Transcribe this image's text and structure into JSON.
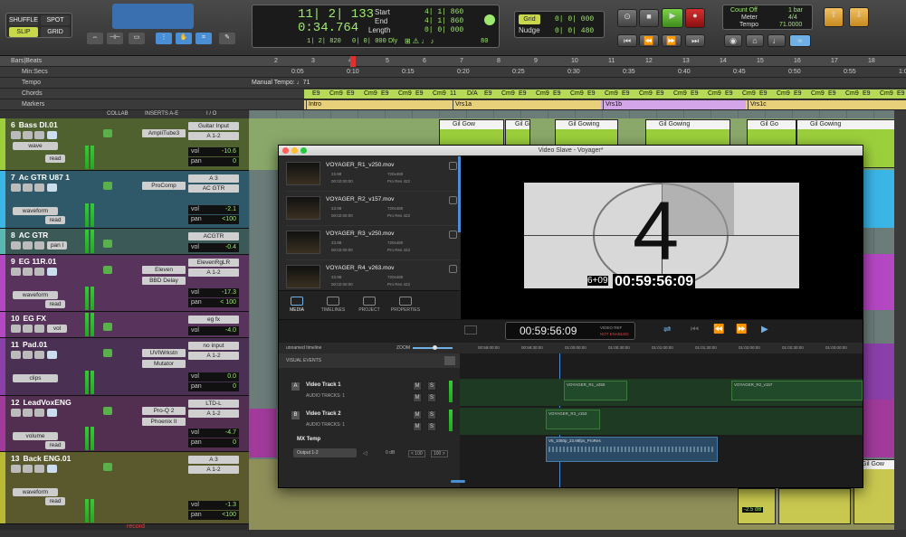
{
  "toolbar": {
    "mode_buttons": [
      "SHUFFLE",
      "SPOT",
      "SLIP",
      "GRID"
    ],
    "counter_main": "11| 2| 133",
    "counter_sub": "0:34.764",
    "start_label": "Start",
    "end_label": "End",
    "length_label": "Length",
    "start_value": "4| 1| 860",
    "end_value": "4| 1| 860",
    "length_value": "0| 0| 000",
    "pre_value": "1| 2| 820",
    "post_value": "0| 0| 000",
    "dly_label": "Dly",
    "tempo_small": "80",
    "grid_label": "Grid",
    "grid_value": "0| 0| 000",
    "nudge_label": "Nudge",
    "nudge_value": "0| 0| 480",
    "count_off": "Count Off",
    "bar_label": "1 bar",
    "meter_label": "Meter",
    "meter_value": "4/4",
    "tempo_label": "Tempo",
    "tempo_value": "71.0000"
  },
  "rulers": {
    "row_names": [
      "Bars|Beats",
      "Min:Secs",
      "Tempo",
      "Chords",
      "Markers"
    ],
    "bar_ticks": [
      "2",
      "3",
      "4",
      "5",
      "6",
      "7",
      "8",
      "9",
      "10",
      "11",
      "12",
      "13",
      "14",
      "15",
      "16",
      "17",
      "18"
    ],
    "time_ticks": [
      "0:05",
      "0:10",
      "0:15",
      "0:20",
      "0:25",
      "0:30",
      "0:35",
      "0:40",
      "0:45",
      "0:50",
      "0:55",
      "1:00"
    ],
    "manual_tempo": "Manual Tempo: ♩71",
    "chords": [
      "E9",
      "Cm9",
      "E9",
      "Cm9",
      "E9",
      "Cm9",
      "E9",
      "Cm9",
      "11",
      "D/A",
      "E9",
      "Cm9",
      "E9",
      "Cm9",
      "E9",
      "Cm9",
      "E9",
      "Cm9",
      "E9",
      "Cm9",
      "E9",
      "Cm9",
      "E9",
      "Cm9",
      "E9",
      "Cm9",
      "E9",
      "Cm9",
      "E9",
      "Cm9",
      "E9",
      "Cm9",
      "E9",
      "Cm9",
      "E9"
    ],
    "markers": [
      "Intro",
      "Vrs1a",
      "Vrs1b",
      "Vrs1c"
    ]
  },
  "mix_headers": {
    "collab": "COLLAB",
    "inserts": "INSERTS A-E",
    "io": "I / O"
  },
  "tracks": [
    {
      "num": "6",
      "name": "Bass DI.01",
      "color": "#9ccf3c",
      "view": "wave",
      "mode": "read",
      "insert1": "AmpliTube3",
      "insert2": "",
      "io_in": "Guitar Input",
      "io_out": "A 1-2",
      "vol": "-10.6",
      "pan": "0"
    },
    {
      "num": "7",
      "name": "Ac GTR U87 1",
      "color": "#3ab5e6",
      "view": "waveform",
      "mode": "read",
      "insert1": "ProComp",
      "insert2": "",
      "io_in": "A 3",
      "io_out": "AC GTR",
      "vol": "-2.1",
      "pan": "<100"
    },
    {
      "num": "8",
      "name": "AC GTR",
      "color": "#59b8b0",
      "view": "pan l",
      "mode": "",
      "insert1": "",
      "insert2": "",
      "io_in": "ACGTR",
      "io_out": "",
      "vol": "-0.4",
      "pan": ""
    },
    {
      "num": "9",
      "name": "EG 11R.01",
      "color": "#b447c2",
      "view": "waveform",
      "mode": "read",
      "insert1": "Eleven",
      "insert2": "BBD Delay",
      "io_in": "ElevenRgLR",
      "io_out": "A 1-2",
      "vol": "-17.3",
      "pan": "< 100"
    },
    {
      "num": "10",
      "name": "EG FX",
      "color": "#b447c2",
      "view": "vol",
      "mode": "",
      "insert1": "",
      "insert2": "",
      "io_in": "eg fx",
      "io_out": "",
      "vol": "-4.0",
      "pan": ""
    },
    {
      "num": "11",
      "name": "Pad.01",
      "color": "#8b3fa8",
      "view": "clips",
      "mode": "",
      "insert1": "UVIWrkstn",
      "insert2": "Mutator",
      "io_in": "no input",
      "io_out": "A 1-2",
      "vol": "0.0",
      "pan": "0"
    },
    {
      "num": "12",
      "name": "LeadVoxENG",
      "color": "#a13a9b",
      "view": "volume",
      "mode": "read",
      "insert1": "Pro-Q 2",
      "insert2": "Phoenix II",
      "io_in": "LTD-L",
      "io_out": "A 1-2",
      "vol": "-4.7",
      "pan": "0"
    },
    {
      "num": "13",
      "name": "Back ENG.01",
      "color": "#b8b834",
      "view": "waveform",
      "mode": "read",
      "insert1": "",
      "insert2": "",
      "io_in": "A 3",
      "io_out": "A 1-2",
      "vol": "-1.3",
      "pan": "<100"
    }
  ],
  "record_label": "record",
  "clips": {
    "gil_gowing": "Gil Gowing",
    "gil_gow": "Gil Gow",
    "gil_gow2": "Gil Go",
    "gain_label": "-2.5 dB"
  },
  "video_slave": {
    "title": "Video Slave - Voyager*",
    "media": [
      {
        "name": "VOYAGER_R1_v250.mov",
        "fps": "23.98",
        "res": "720x480",
        "dur": "00:02:00:00",
        "codec": "Pro Res 422"
      },
      {
        "name": "VOYAGER_R2_v157.mov",
        "fps": "23.98",
        "res": "720x480",
        "dur": "00:02:00:00",
        "codec": "Pro Res 422"
      },
      {
        "name": "VOYAGER_R3_v250.mov",
        "fps": "23.98",
        "res": "720x480",
        "dur": "00:02:00:00",
        "codec": "Pro Res 422"
      },
      {
        "name": "VOYAGER_R4_v263.mov",
        "fps": "23.98",
        "res": "720x480",
        "dur": "00:02:00:00",
        "codec": "Pro Res 422"
      }
    ],
    "tabs": [
      "MEDIA",
      "TIMELINES",
      "PROJECT",
      "PROPERTIES"
    ],
    "countdown_digit": "4",
    "burn_in_prefix": "6+09",
    "burn_in_tc": "00:59:56:09",
    "main_timecode": "00:59:56:09",
    "video_ref": "VIDEO REF",
    "not_enabled": "NOT ENABLED",
    "timeline_name": "unnamed timeline",
    "zoom_label": "ZOOM",
    "ruler_times": [
      "00:59:00:00",
      "00:59:30:00",
      "01:00:00:00",
      "01:00:30:00",
      "01:01:00:00",
      "01:01:30:00",
      "01:02:00:00",
      "01:02:30:00",
      "01:03:00:00"
    ],
    "visual_events": "VISUAL EVENTS",
    "video_tracks": [
      {
        "letter": "A",
        "name": "Video Track 1",
        "audio": "AUDIO TRACKS: 1"
      },
      {
        "letter": "B",
        "name": "Video Track 2",
        "audio": "AUDIO TRACKS: 1"
      }
    ],
    "mx_temp": "MX Temp",
    "output_select": "Output 1-2",
    "db_value": "0 dB",
    "pan_l": "< 100",
    "pan_r": "100 >",
    "clips": [
      "VOYAGER_R1_v250",
      "VOYAGER_R2_v157",
      "VOYAGER_R3_v153"
    ],
    "audio_clip": "V5_1080p_23.98fps_ProRes"
  }
}
